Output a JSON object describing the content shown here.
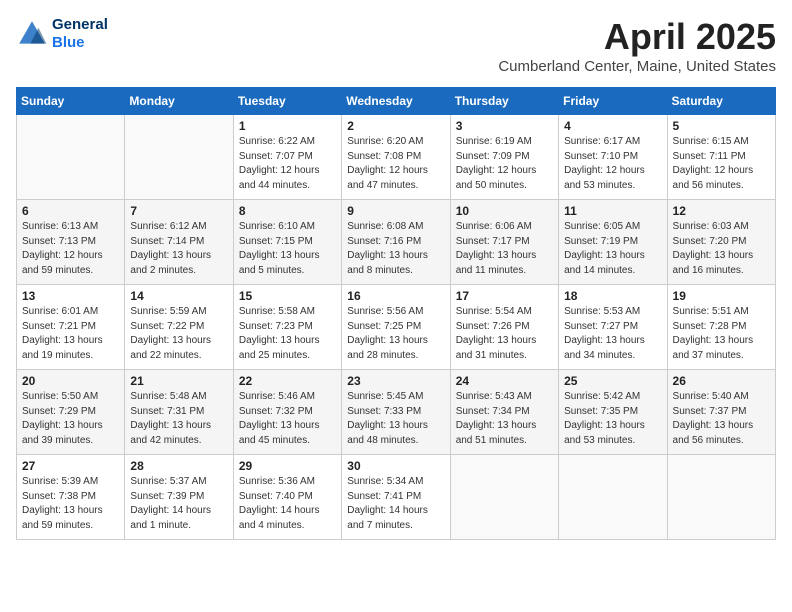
{
  "logo": {
    "line1": "General",
    "line2": "Blue"
  },
  "title": "April 2025",
  "subtitle": "Cumberland Center, Maine, United States",
  "days_of_week": [
    "Sunday",
    "Monday",
    "Tuesday",
    "Wednesday",
    "Thursday",
    "Friday",
    "Saturday"
  ],
  "weeks": [
    [
      {
        "day": "",
        "info": ""
      },
      {
        "day": "",
        "info": ""
      },
      {
        "day": "1",
        "info": "Sunrise: 6:22 AM\nSunset: 7:07 PM\nDaylight: 12 hours\nand 44 minutes."
      },
      {
        "day": "2",
        "info": "Sunrise: 6:20 AM\nSunset: 7:08 PM\nDaylight: 12 hours\nand 47 minutes."
      },
      {
        "day": "3",
        "info": "Sunrise: 6:19 AM\nSunset: 7:09 PM\nDaylight: 12 hours\nand 50 minutes."
      },
      {
        "day": "4",
        "info": "Sunrise: 6:17 AM\nSunset: 7:10 PM\nDaylight: 12 hours\nand 53 minutes."
      },
      {
        "day": "5",
        "info": "Sunrise: 6:15 AM\nSunset: 7:11 PM\nDaylight: 12 hours\nand 56 minutes."
      }
    ],
    [
      {
        "day": "6",
        "info": "Sunrise: 6:13 AM\nSunset: 7:13 PM\nDaylight: 12 hours\nand 59 minutes."
      },
      {
        "day": "7",
        "info": "Sunrise: 6:12 AM\nSunset: 7:14 PM\nDaylight: 13 hours\nand 2 minutes."
      },
      {
        "day": "8",
        "info": "Sunrise: 6:10 AM\nSunset: 7:15 PM\nDaylight: 13 hours\nand 5 minutes."
      },
      {
        "day": "9",
        "info": "Sunrise: 6:08 AM\nSunset: 7:16 PM\nDaylight: 13 hours\nand 8 minutes."
      },
      {
        "day": "10",
        "info": "Sunrise: 6:06 AM\nSunset: 7:17 PM\nDaylight: 13 hours\nand 11 minutes."
      },
      {
        "day": "11",
        "info": "Sunrise: 6:05 AM\nSunset: 7:19 PM\nDaylight: 13 hours\nand 14 minutes."
      },
      {
        "day": "12",
        "info": "Sunrise: 6:03 AM\nSunset: 7:20 PM\nDaylight: 13 hours\nand 16 minutes."
      }
    ],
    [
      {
        "day": "13",
        "info": "Sunrise: 6:01 AM\nSunset: 7:21 PM\nDaylight: 13 hours\nand 19 minutes."
      },
      {
        "day": "14",
        "info": "Sunrise: 5:59 AM\nSunset: 7:22 PM\nDaylight: 13 hours\nand 22 minutes."
      },
      {
        "day": "15",
        "info": "Sunrise: 5:58 AM\nSunset: 7:23 PM\nDaylight: 13 hours\nand 25 minutes."
      },
      {
        "day": "16",
        "info": "Sunrise: 5:56 AM\nSunset: 7:25 PM\nDaylight: 13 hours\nand 28 minutes."
      },
      {
        "day": "17",
        "info": "Sunrise: 5:54 AM\nSunset: 7:26 PM\nDaylight: 13 hours\nand 31 minutes."
      },
      {
        "day": "18",
        "info": "Sunrise: 5:53 AM\nSunset: 7:27 PM\nDaylight: 13 hours\nand 34 minutes."
      },
      {
        "day": "19",
        "info": "Sunrise: 5:51 AM\nSunset: 7:28 PM\nDaylight: 13 hours\nand 37 minutes."
      }
    ],
    [
      {
        "day": "20",
        "info": "Sunrise: 5:50 AM\nSunset: 7:29 PM\nDaylight: 13 hours\nand 39 minutes."
      },
      {
        "day": "21",
        "info": "Sunrise: 5:48 AM\nSunset: 7:31 PM\nDaylight: 13 hours\nand 42 minutes."
      },
      {
        "day": "22",
        "info": "Sunrise: 5:46 AM\nSunset: 7:32 PM\nDaylight: 13 hours\nand 45 minutes."
      },
      {
        "day": "23",
        "info": "Sunrise: 5:45 AM\nSunset: 7:33 PM\nDaylight: 13 hours\nand 48 minutes."
      },
      {
        "day": "24",
        "info": "Sunrise: 5:43 AM\nSunset: 7:34 PM\nDaylight: 13 hours\nand 51 minutes."
      },
      {
        "day": "25",
        "info": "Sunrise: 5:42 AM\nSunset: 7:35 PM\nDaylight: 13 hours\nand 53 minutes."
      },
      {
        "day": "26",
        "info": "Sunrise: 5:40 AM\nSunset: 7:37 PM\nDaylight: 13 hours\nand 56 minutes."
      }
    ],
    [
      {
        "day": "27",
        "info": "Sunrise: 5:39 AM\nSunset: 7:38 PM\nDaylight: 13 hours\nand 59 minutes."
      },
      {
        "day": "28",
        "info": "Sunrise: 5:37 AM\nSunset: 7:39 PM\nDaylight: 14 hours\nand 1 minute."
      },
      {
        "day": "29",
        "info": "Sunrise: 5:36 AM\nSunset: 7:40 PM\nDaylight: 14 hours\nand 4 minutes."
      },
      {
        "day": "30",
        "info": "Sunrise: 5:34 AM\nSunset: 7:41 PM\nDaylight: 14 hours\nand 7 minutes."
      },
      {
        "day": "",
        "info": ""
      },
      {
        "day": "",
        "info": ""
      },
      {
        "day": "",
        "info": ""
      }
    ]
  ]
}
